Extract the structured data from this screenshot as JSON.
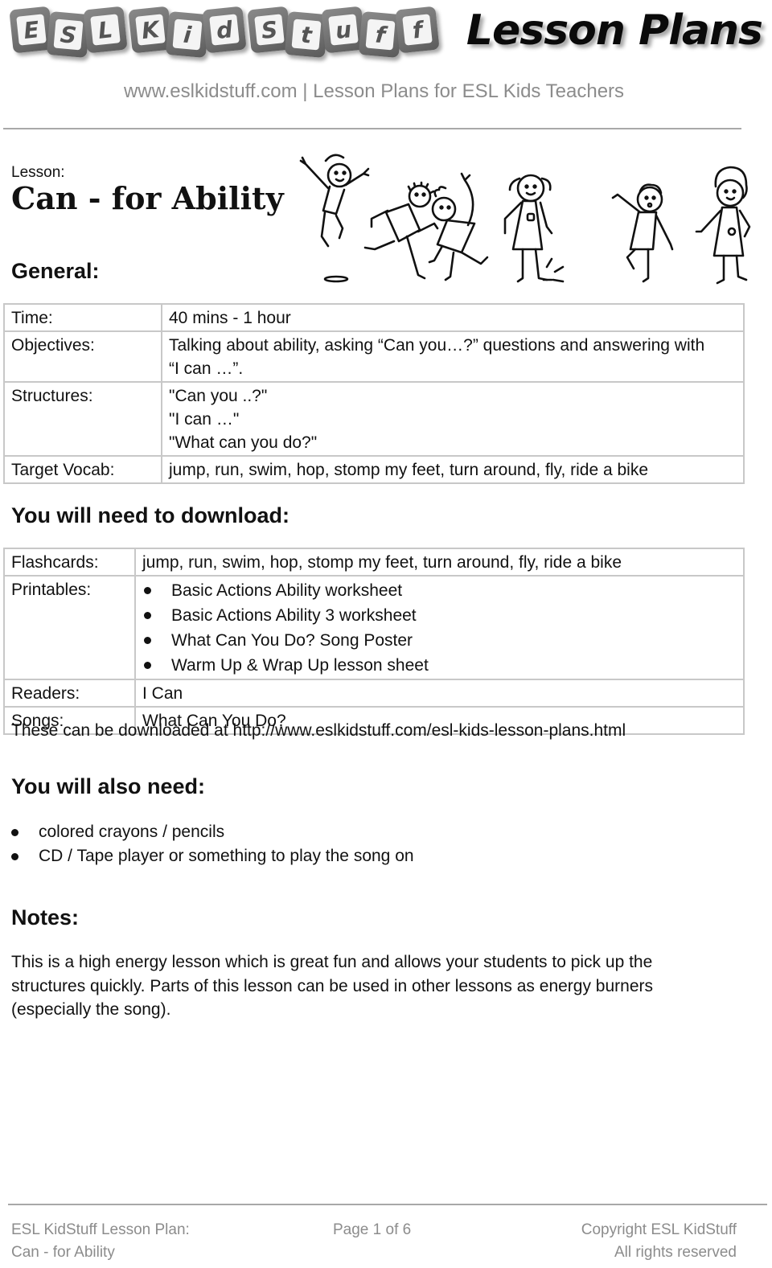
{
  "header": {
    "logo_blocks": [
      {
        "word": "ESL",
        "letters": [
          "E",
          "S",
          "L"
        ]
      },
      {
        "word": "Kid",
        "letters": [
          "K",
          "i",
          "d"
        ]
      },
      {
        "word": "Stuff",
        "letters": [
          "S",
          "t",
          "u",
          "f",
          "f"
        ]
      }
    ],
    "logo_title": "Lesson Plans",
    "tagline": "www.eslkidstuff.com | Lesson Plans for ESL Kids Teachers"
  },
  "lesson": {
    "label": "Lesson:",
    "title": "Can - for Ability",
    "illustration": "six-kids-doing-actions"
  },
  "general": {
    "heading": "General:",
    "rows": [
      {
        "label": "Time:",
        "lines": [
          "40 mins - 1 hour"
        ]
      },
      {
        "label": "Objectives:",
        "lines": [
          "Talking about ability, asking “Can you…?” questions and answering with",
          "“I can …”."
        ]
      },
      {
        "label": "Structures:",
        "lines": [
          "\"Can you ..?\"",
          "\"I can …\"",
          "\"What can you do?\""
        ]
      },
      {
        "label": "Target Vocab:",
        "lines": [
          "jump, run, swim, hop, stomp my feet, turn around, fly, ride a bike"
        ]
      }
    ]
  },
  "download": {
    "heading": "You will need to download:",
    "rows": [
      {
        "label": "Flashcards:",
        "text": "jump, run, swim, hop, stomp my feet, turn around, fly, ride a bike"
      },
      {
        "label": "Printables:",
        "items": [
          "Basic Actions Ability worksheet",
          "Basic Actions Ability 3 worksheet",
          "What Can You Do? Song Poster",
          "Warm Up & Wrap Up lesson sheet"
        ]
      },
      {
        "label": "Readers:",
        "text": "I Can"
      },
      {
        "label": "Songs:",
        "text": "What Can You Do?"
      }
    ],
    "note": "These can be downloaded at http://www.eslkidstuff.com/esl-kids-lesson-plans.html"
  },
  "also_need": {
    "heading": "You will also need:",
    "items": [
      "colored crayons / pencils",
      "CD / Tape player or something to play the song on"
    ]
  },
  "notes": {
    "heading": "Notes:",
    "text": "This is a high energy lesson which is great fun and allows your students to pick up the structures quickly.  Parts of this lesson can be used in other lessons as energy burners (especially the song)."
  },
  "footer": {
    "left_line1": "ESL KidStuff Lesson Plan:",
    "left_line2": "Can - for Ability",
    "center": "Page 1 of 6",
    "right_line1": "Copyright ESL KidStuff",
    "right_line2": "All rights reserved"
  }
}
